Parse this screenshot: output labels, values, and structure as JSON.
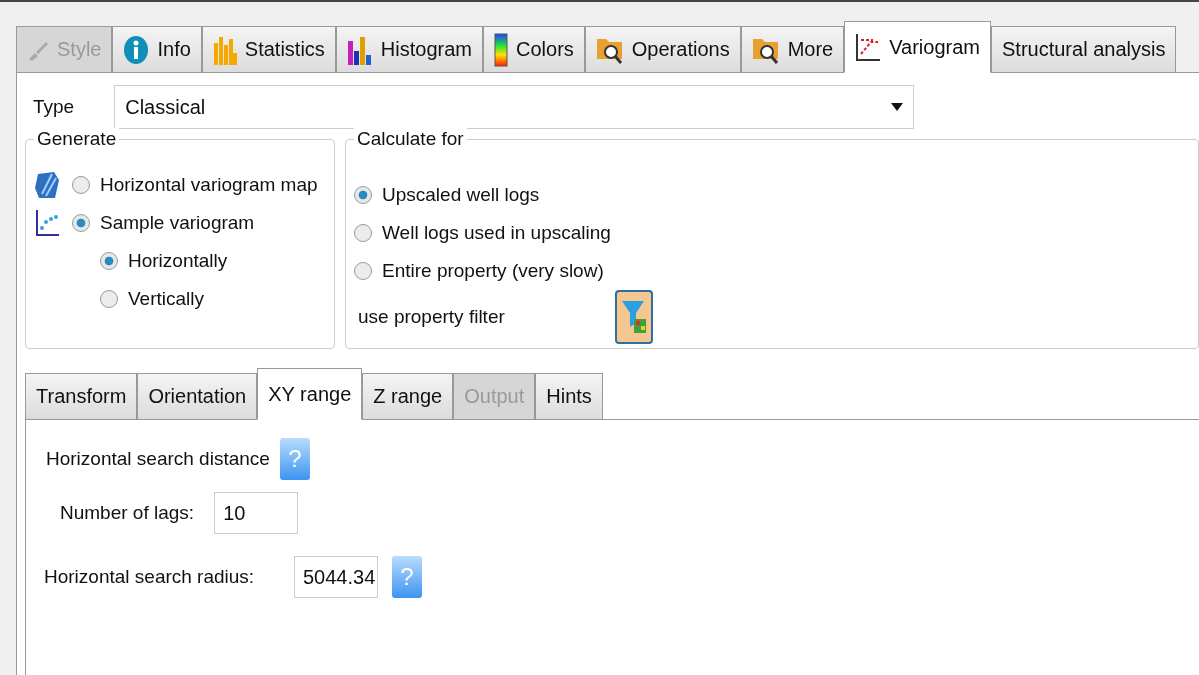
{
  "tabs": [
    {
      "label": "Style",
      "selected": false,
      "disabled": true
    },
    {
      "label": "Info",
      "selected": false,
      "disabled": false
    },
    {
      "label": "Statistics",
      "selected": false,
      "disabled": false
    },
    {
      "label": "Histogram",
      "selected": false,
      "disabled": false
    },
    {
      "label": "Colors",
      "selected": false,
      "disabled": false
    },
    {
      "label": "Operations",
      "selected": false,
      "disabled": false
    },
    {
      "label": "More",
      "selected": false,
      "disabled": false
    },
    {
      "label": "Variogram",
      "selected": true,
      "disabled": false
    },
    {
      "label": "Structural analysis",
      "selected": false,
      "disabled": false
    }
  ],
  "type_field": {
    "label": "Type",
    "value": "Classical"
  },
  "generate": {
    "title": "Generate",
    "options": [
      {
        "label": "Horizontal variogram map",
        "selected": false
      },
      {
        "label": "Sample variogram",
        "selected": true,
        "children": [
          {
            "label": "Horizontally",
            "selected": true
          },
          {
            "label": "Vertically",
            "selected": false
          }
        ]
      }
    ]
  },
  "calculate_for": {
    "title": "Calculate for",
    "options": [
      {
        "label": "Upscaled well logs",
        "selected": true
      },
      {
        "label": "Well logs used in upscaling",
        "selected": false
      },
      {
        "label": "Entire property (very slow)",
        "selected": false
      }
    ],
    "filter_label": "use property filter"
  },
  "sub_tabs": [
    {
      "label": "Transform",
      "selected": false,
      "disabled": false
    },
    {
      "label": "Orientation",
      "selected": false,
      "disabled": false
    },
    {
      "label": "XY range",
      "selected": true,
      "disabled": false
    },
    {
      "label": "Z range",
      "selected": false,
      "disabled": false
    },
    {
      "label": "Output",
      "selected": false,
      "disabled": true
    },
    {
      "label": "Hints",
      "selected": false,
      "disabled": false
    }
  ],
  "xy_range": {
    "heading": "Horizontal search distance",
    "help_icon": "?",
    "lags_label": "Number of lags:",
    "lags_value": "10",
    "radius_label": "Horizontal search radius:",
    "radius_value": "5044.34",
    "radius_help": "?"
  }
}
